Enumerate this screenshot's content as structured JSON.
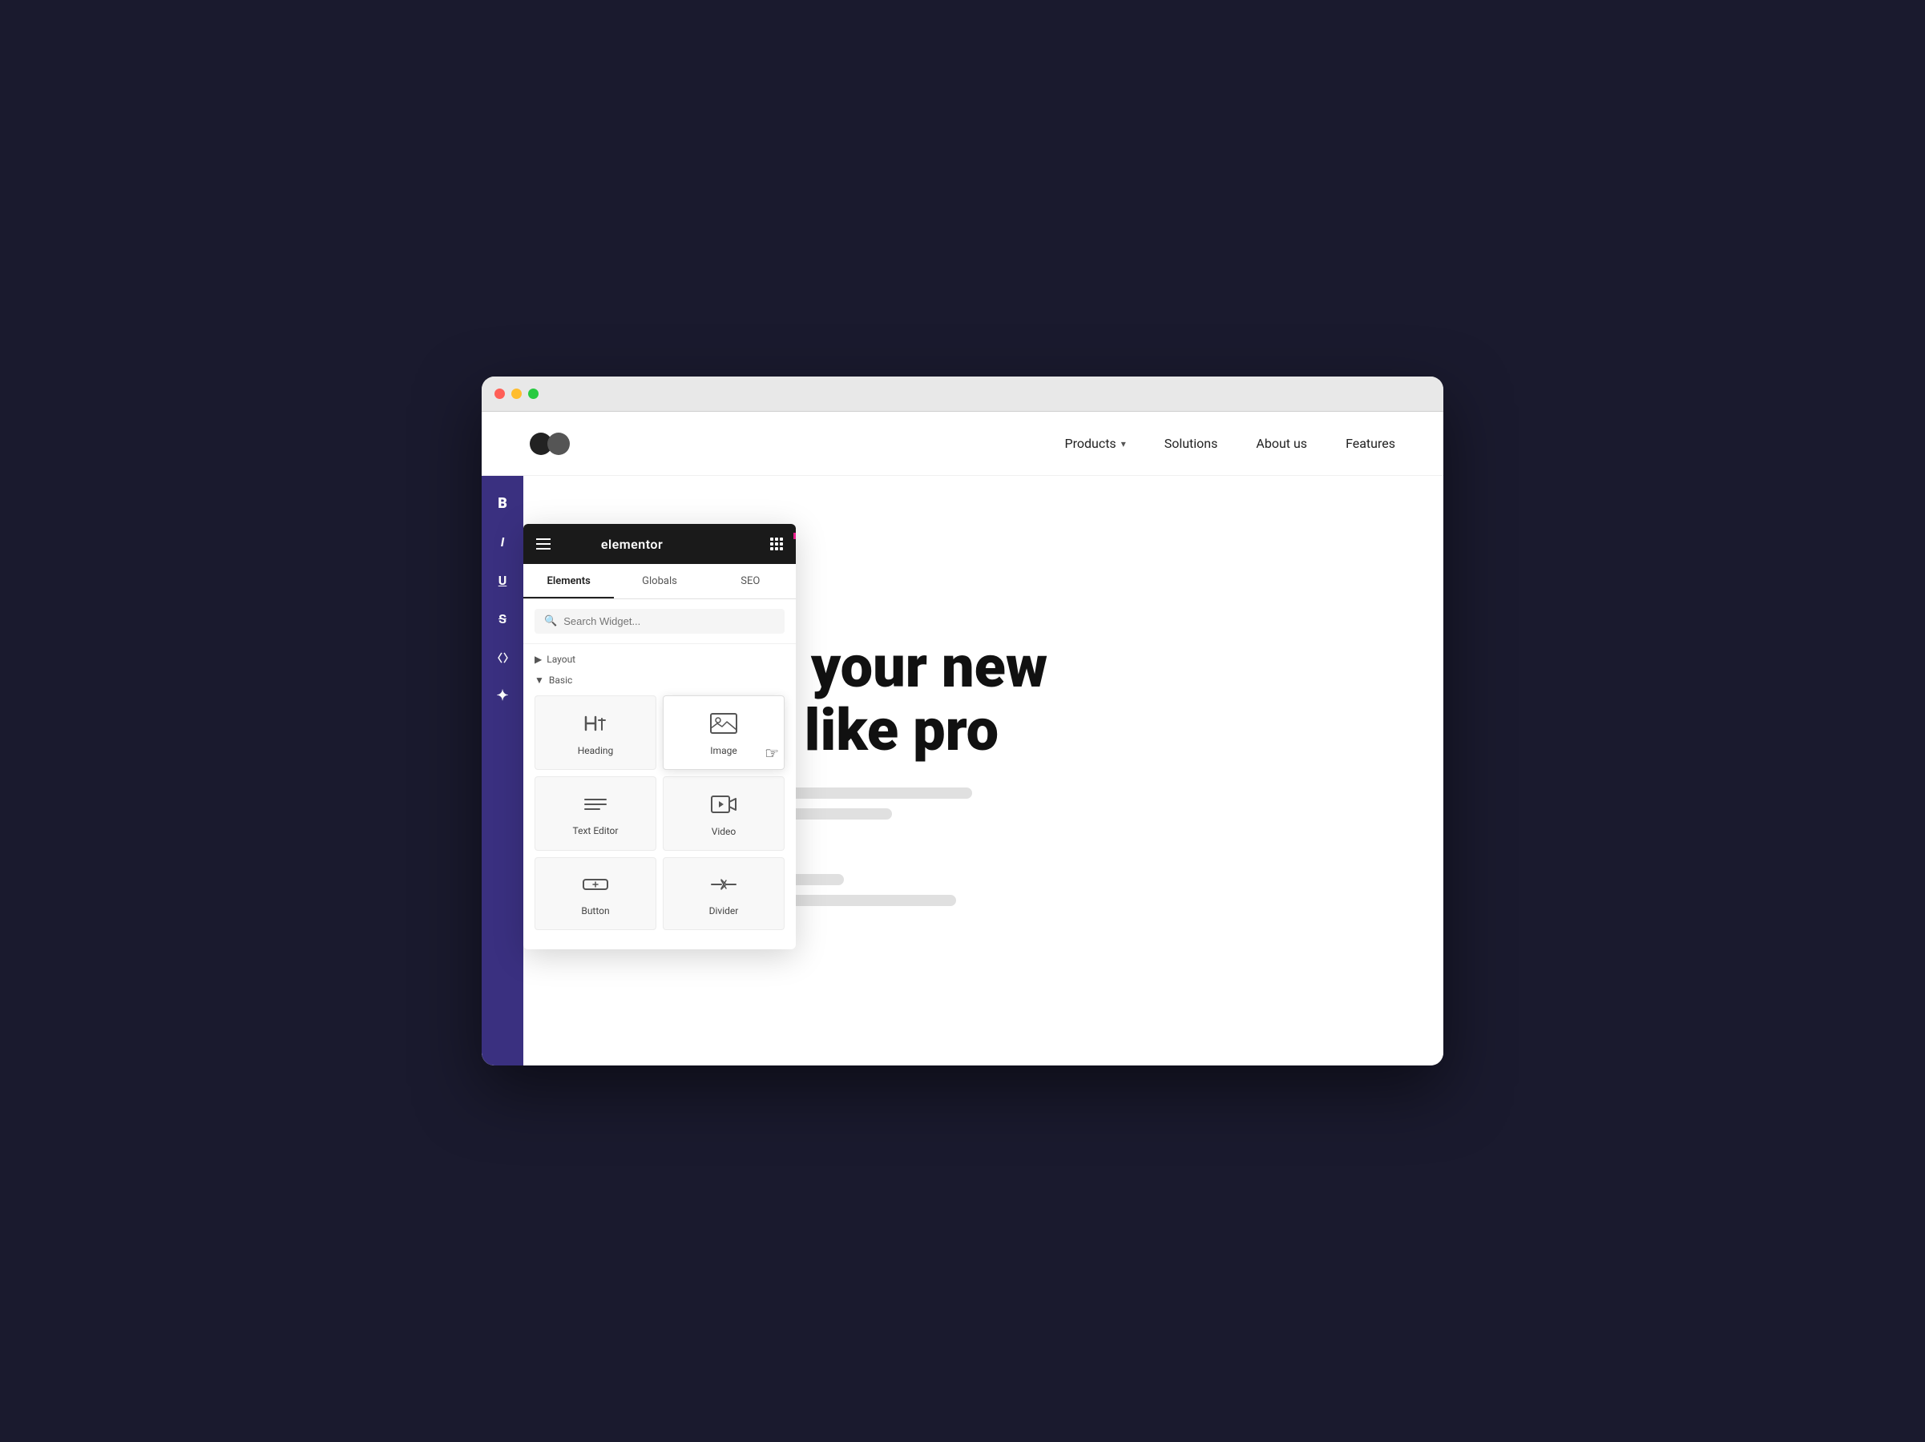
{
  "browser": {
    "traffic_lights": [
      "red",
      "yellow",
      "green"
    ]
  },
  "navbar": {
    "logo_alt": "Logo",
    "nav_links": [
      {
        "label": "Products",
        "has_dropdown": true
      },
      {
        "label": "Solutions",
        "has_dropdown": false
      },
      {
        "label": "About us",
        "has_dropdown": false
      },
      {
        "label": "Features",
        "has_dropdown": false
      }
    ]
  },
  "toolbar": {
    "buttons": [
      {
        "id": "bold",
        "label": "B",
        "style": "bold"
      },
      {
        "id": "italic",
        "label": "I",
        "style": "italic"
      },
      {
        "id": "underline",
        "label": "U",
        "style": "underline"
      },
      {
        "id": "strikethrough",
        "label": "S",
        "style": "strikethrough"
      },
      {
        "id": "code",
        "label": "< >",
        "style": "code"
      },
      {
        "id": "magic",
        "label": "✦",
        "style": ""
      }
    ]
  },
  "hero": {
    "title_line1": "Manage your new",
    "title_line2": "website like pro"
  },
  "elementor": {
    "title": "elementor",
    "tabs": [
      {
        "label": "Elements",
        "active": true
      },
      {
        "label": "Globals",
        "active": false
      },
      {
        "label": "SEO",
        "active": false
      }
    ],
    "search_placeholder": "Search Widget...",
    "sections": [
      {
        "label": "Layout",
        "collapsed": true,
        "arrow": "▶"
      },
      {
        "label": "Basic",
        "collapsed": false,
        "arrow": "▼"
      }
    ],
    "widgets": [
      {
        "id": "heading",
        "label": "Heading",
        "icon": "heading"
      },
      {
        "id": "image",
        "label": "Image",
        "icon": "image",
        "highlighted": true
      },
      {
        "id": "text-editor",
        "label": "Text Editor",
        "icon": "text-editor"
      },
      {
        "id": "video",
        "label": "Video",
        "icon": "video"
      },
      {
        "id": "button",
        "label": "Button",
        "icon": "button"
      },
      {
        "id": "divider",
        "label": "Divider",
        "icon": "divider"
      }
    ]
  }
}
